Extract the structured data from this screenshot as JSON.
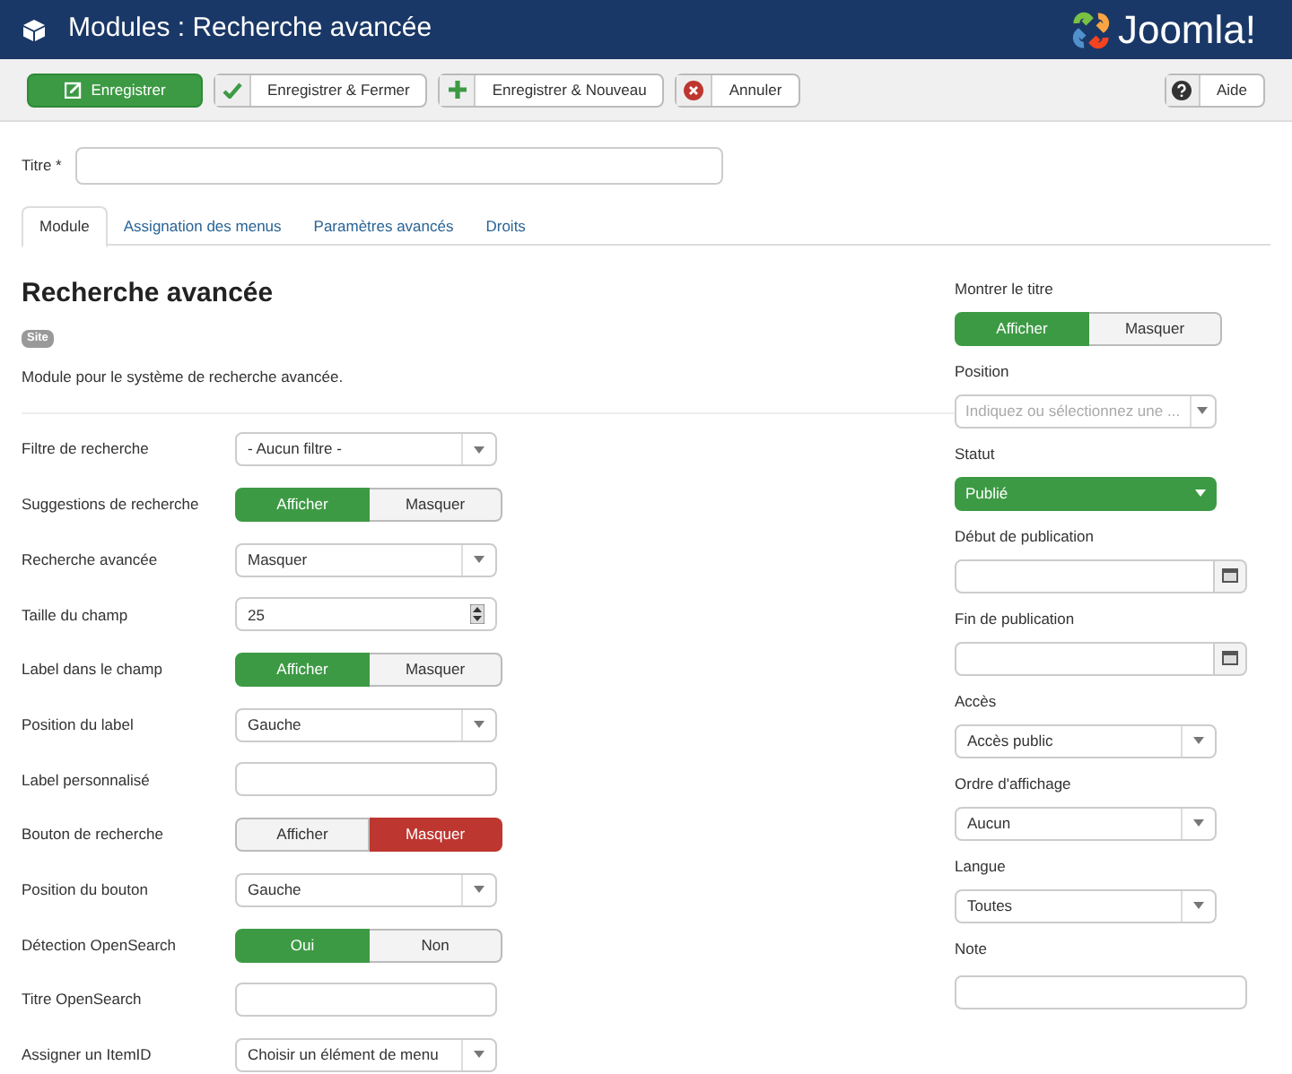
{
  "header": {
    "title": "Modules : Recherche avancée",
    "logo": "Joomla!"
  },
  "toolbar": [
    {
      "kind": "save",
      "label": "Enregistrer"
    },
    {
      "kind": "check",
      "label": "Enregistrer & Fermer"
    },
    {
      "kind": "plus",
      "label": "Enregistrer & Nouveau"
    },
    {
      "kind": "cancel",
      "label": "Annuler"
    }
  ],
  "help_button": {
    "label": "Aide"
  },
  "title_field": {
    "label": "Titre *"
  },
  "tabs": [
    {
      "label": "Module",
      "selected": true
    },
    {
      "label": "Assignation des menus",
      "selected": false
    },
    {
      "label": "Paramètres avancés",
      "selected": false
    },
    {
      "label": "Droits",
      "selected": false
    }
  ],
  "module": {
    "heading": "Recherche avancée",
    "badge": "Site",
    "description": "Module pour le système de recherche avancée."
  },
  "fields": [
    {
      "kind": "select",
      "label": "Filtre de recherche",
      "value": "- Aucun filtre -"
    },
    {
      "kind": "toggle",
      "label": "Suggestions de recherche",
      "color": "#3d9a44",
      "options": [
        {
          "label": "Afficher",
          "selected": true
        },
        {
          "label": "Masquer",
          "selected": false
        }
      ]
    },
    {
      "kind": "select",
      "label": "Recherche avancée",
      "value": "Masquer"
    },
    {
      "kind": "number",
      "label": "Taille du champ",
      "value": "25"
    },
    {
      "kind": "toggle",
      "label": "Label dans le champ",
      "color": "#3d9a44",
      "options": [
        {
          "label": "Afficher",
          "selected": true
        },
        {
          "label": "Masquer",
          "selected": false
        }
      ]
    },
    {
      "kind": "select",
      "label": "Position du label",
      "value": "Gauche"
    },
    {
      "kind": "text",
      "label": "Label personnalisé"
    },
    {
      "kind": "toggle",
      "label": "Bouton de recherche",
      "color": "#bd362f",
      "options": [
        {
          "label": "Afficher",
          "selected": false
        },
        {
          "label": "Masquer",
          "selected": true
        }
      ]
    },
    {
      "kind": "select",
      "label": "Position du bouton",
      "value": "Gauche"
    },
    {
      "kind": "toggle",
      "label": "Détection OpenSearch",
      "color": "#3d9a44",
      "options": [
        {
          "label": "Oui",
          "selected": true
        },
        {
          "label": "Non",
          "selected": false
        }
      ]
    },
    {
      "kind": "text",
      "label": "Titre OpenSearch"
    },
    {
      "kind": "select",
      "label": "Assigner un ItemID",
      "value": "Choisir un élément de menu"
    }
  ],
  "side_fields": [
    {
      "kind": "toggle",
      "label": "Montrer le titre",
      "color": "#3d9a44",
      "options": [
        {
          "label": "Afficher",
          "selected": true
        },
        {
          "label": "Masquer",
          "selected": false
        }
      ]
    },
    {
      "kind": "select",
      "label": "Position",
      "placeholder": "Indiquez ou sélectionnez une ..."
    },
    {
      "kind": "status",
      "label": "Statut",
      "value": "Publié"
    },
    {
      "kind": "date",
      "label": "Début de publication"
    },
    {
      "kind": "date",
      "label": "Fin de publication"
    },
    {
      "kind": "select",
      "label": "Accès",
      "value": "Accès public"
    },
    {
      "kind": "select",
      "label": "Ordre d'affichage",
      "value": "Aucun"
    },
    {
      "kind": "select",
      "label": "Langue",
      "value": "Toutes"
    },
    {
      "kind": "text",
      "label": "Note"
    }
  ]
}
